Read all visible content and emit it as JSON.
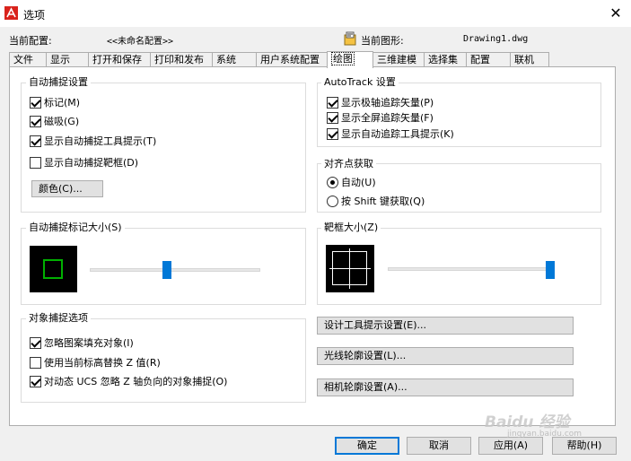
{
  "window": {
    "title": "选项",
    "close_glyph": "✕"
  },
  "header": {
    "profile_label": "当前配置:",
    "profile_value": "<<未命名配置>>",
    "drawing_label": "当前图形:",
    "drawing_value": "Drawing1.dwg"
  },
  "tabs": [
    {
      "label": "文件"
    },
    {
      "label": "显示"
    },
    {
      "label": "打开和保存"
    },
    {
      "label": "打印和发布"
    },
    {
      "label": "系统"
    },
    {
      "label": "用户系统配置"
    },
    {
      "label": "绘图",
      "active": true
    },
    {
      "label": "三维建模"
    },
    {
      "label": "选择集"
    },
    {
      "label": "配置"
    },
    {
      "label": "联机"
    }
  ],
  "autosnap": {
    "legend": "自动捕捉设置",
    "options": [
      {
        "label": "标记(M)",
        "checked": true
      },
      {
        "label": "磁吸(G)",
        "checked": true
      },
      {
        "label": "显示自动捕捉工具提示(T)",
        "checked": true
      },
      {
        "label": "显示自动捕捉靶框(D)",
        "checked": false
      }
    ],
    "color_button": "颜色(C)..."
  },
  "autotrack": {
    "legend": "AutoTrack 设置",
    "options": [
      {
        "label": "显示极轴追踪矢量(P)",
        "checked": true
      },
      {
        "label": "显示全屏追踪矢量(F)",
        "checked": true
      },
      {
        "label": "显示自动追踪工具提示(K)",
        "checked": true
      }
    ]
  },
  "alignment": {
    "legend": "对齐点获取",
    "options": [
      {
        "label": "自动(U)",
        "checked": true
      },
      {
        "label": "按 Shift 键获取(Q)",
        "checked": false
      }
    ]
  },
  "marker_size": {
    "legend": "自动捕捉标记大小(S)",
    "level": 0.45,
    "marker_color": "#00b000"
  },
  "aperture_size": {
    "legend": "靶框大小(Z)",
    "level": 0.98
  },
  "osnap_options": {
    "legend": "对象捕捉选项",
    "options": [
      {
        "label": "忽略图案填充对象(I)",
        "checked": true
      },
      {
        "label": "使用当前标高替换 Z 值(R)",
        "checked": false
      },
      {
        "label": "对动态 UCS 忽略 Z 轴负向的对象捕捉(O)",
        "checked": true
      }
    ]
  },
  "side_buttons": [
    {
      "label": "设计工具提示设置(E)..."
    },
    {
      "label": "光线轮廓设置(L)..."
    },
    {
      "label": "相机轮廓设置(A)..."
    }
  ],
  "footer": {
    "ok": "确定",
    "cancel": "取消",
    "apply": "应用(A)",
    "help": "帮助(H)"
  },
  "watermark": {
    "brand": "Baidu 经验",
    "url": "jingyan.baidu.com"
  },
  "colors": {
    "accent": "#0078d7",
    "app_icon": "#d9231c"
  }
}
